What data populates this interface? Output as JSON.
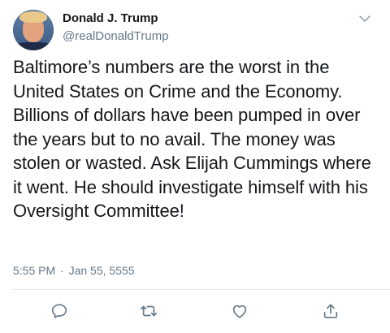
{
  "tweet": {
    "display_name": "Donald J. Trump",
    "handle": "@realDonaldTrump",
    "text": "Baltimore’s numbers are the worst in the United States on Crime and the Economy. Billions of dollars have been pumped in over the years but to no avail. The money was stolen or wasted. Ask Elijah Cummings where it went. He should investigate himself with his Oversight Committee!",
    "time": "5:55 PM",
    "separator": "·",
    "date": "Jan 55, 5555"
  },
  "icons": {
    "menu": "chevron-down-icon",
    "reply": "reply-icon",
    "retweet": "retweet-icon",
    "like": "heart-icon",
    "share": "share-icon"
  },
  "colors": {
    "text": "#14171a",
    "secondary": "#657786",
    "divider": "#e1e8ed"
  }
}
